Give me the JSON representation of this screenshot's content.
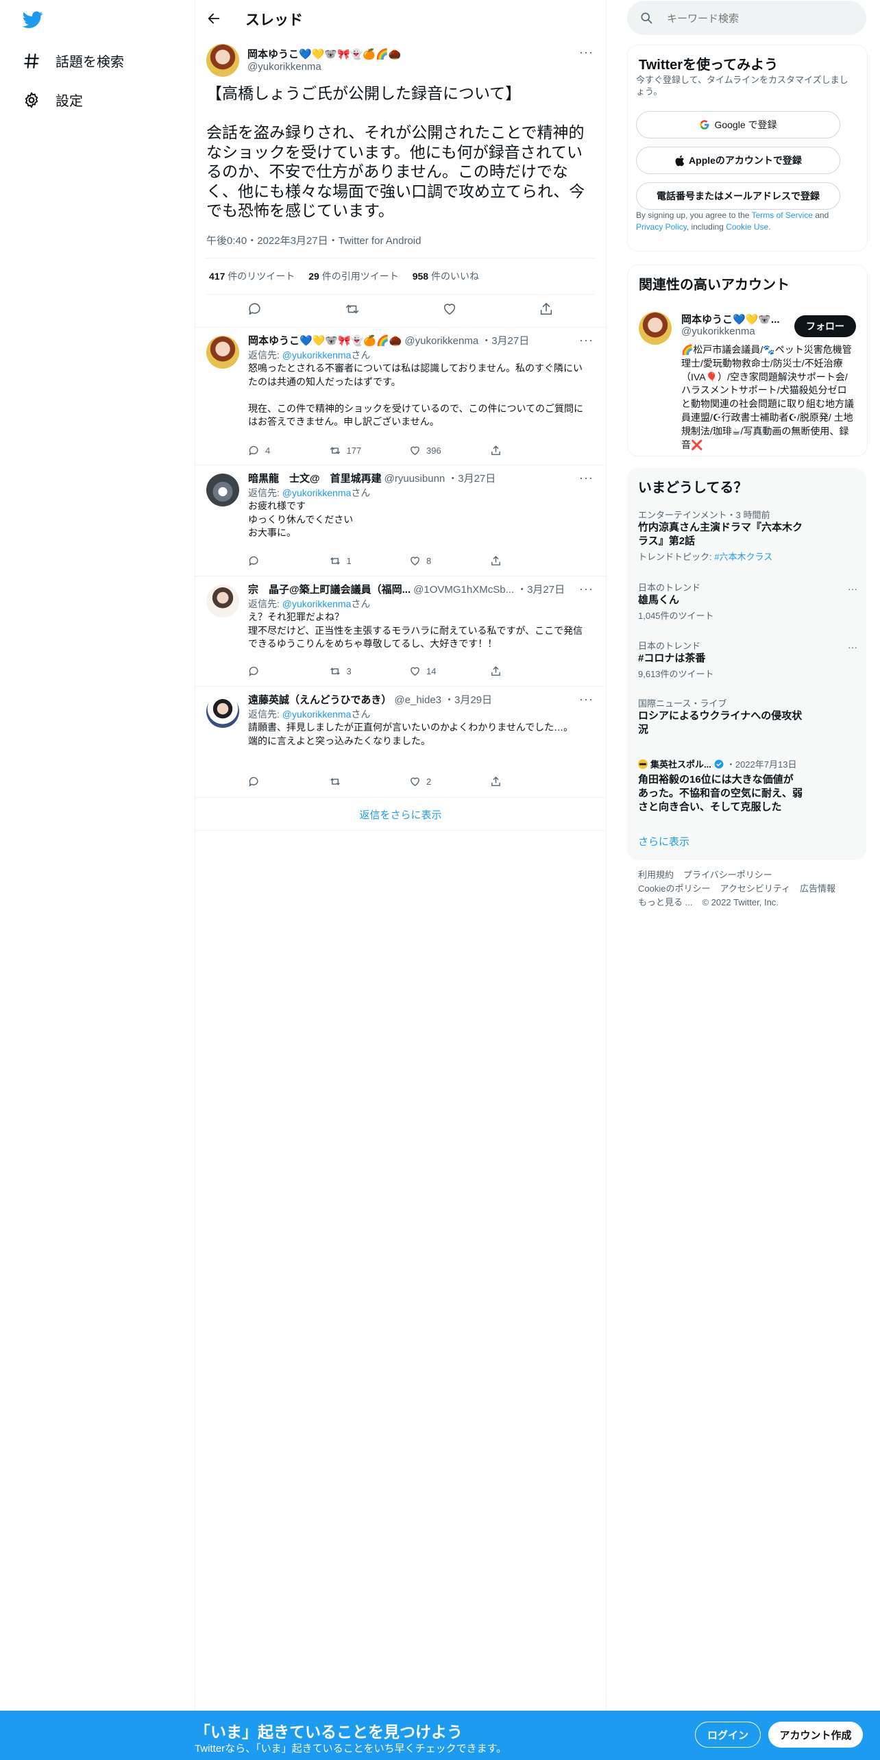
{
  "nav": {
    "logo": "twitter-bird",
    "explore_label": "話題を検索",
    "settings_label": "設定"
  },
  "header": {
    "title": "スレッド"
  },
  "main_tweet": {
    "name": "岡本ゆうこ💙💛🐨🎀👻🍊🌈🌰",
    "handle": "@yukorikkenma",
    "text": "【高橋しょうご氏が公開した録音について】\n\n会話を盗み録りされ、それが公開されたことで精神的なショックを受けています。他にも何が録音されているのか、不安で仕方がありません。この時だけでなく、他にも様々な場面で強い口調で攻め立てられ、今でも恐怖を感じています。",
    "meta": "午後0:40・2022年3月27日・Twitter for Android",
    "retweets": "417",
    "retweets_label": "件のリツイート",
    "quotes": "29",
    "quotes_label": "件の引用ツイート",
    "likes": "958",
    "likes_label": "件のいいね"
  },
  "replies": [
    {
      "name": "岡本ゆうこ💙💛🐨🎀👻🍊🌈🌰",
      "handle": "@yukorikkenma",
      "date": "・3月27日",
      "reply_prefix": "返信先: ",
      "reply_to": "@yukorikkenma",
      "reply_suffix": "さん",
      "text": "怒鳴ったとされる不審者については私は認識しておりません。私のすぐ隣にいたのは共通の知人だったはずです。\n\n現在、この件で精神的ショックを受けているので、この件についてのご質問にはお答えできません。申し訳ございません。",
      "reply_count": "4",
      "retweet_count": "177",
      "like_count": "396"
    },
    {
      "name": "暗黒龍　士文@　首里城再建",
      "handle": "@ryuusibunn",
      "date": "・3月27日",
      "reply_prefix": "返信先: ",
      "reply_to": "@yukorikkenma",
      "reply_suffix": "さん",
      "text": "お疲れ様です\nゆっくり休んでください\nお大事に。",
      "reply_count": "",
      "retweet_count": "1",
      "like_count": "8"
    },
    {
      "name": "宗　晶子@築上町議会議員（福岡...",
      "handle": "@1OVMG1hXMcSb...",
      "date": "・3月27日",
      "reply_prefix": "返信先: ",
      "reply_to": "@yukorikkenma",
      "reply_suffix": "さん",
      "text": "え？それ犯罪だよね？\n理不尽だけど、正当性を主張するモラハラに耐えている私ですが、ここで発信できるゆうこりんをめちゃ尊敬してるし、大好きです！！",
      "reply_count": "",
      "retweet_count": "3",
      "like_count": "14"
    },
    {
      "name": "遠藤英誠（えんどうひであき）",
      "handle": "@e_hide3",
      "date": "・3月29日",
      "reply_prefix": "返信先: ",
      "reply_to": "@yukorikkenma",
      "reply_suffix": "さん",
      "text": "請願書、拝見しましたが正直何が言いたいのかよくわかりませんでした…。\n端的に言えよと突っ込みたくなりました。",
      "reply_count": "",
      "retweet_count": "",
      "like_count": "2"
    }
  ],
  "show_more_replies": "返信をさらに表示",
  "search": {
    "placeholder": "キーワード検索"
  },
  "signup": {
    "title": "Twitterを使ってみよう",
    "subtitle": "今すぐ登録して、タイムラインをカスタマイズしましょう。",
    "google": "Google で登録",
    "apple": "Appleのアカウントで登録",
    "phone": "電話番号またはメールアドレスで登録",
    "legal_1": "By signing up, you agree to the ",
    "terms": "Terms of Service",
    "legal_2": " and ",
    "privacy": "Privacy Policy",
    "legal_3": ", including ",
    "cookie": "Cookie Use",
    "legal_4": "."
  },
  "related": {
    "title": "関連性の高いアカウント",
    "name": "岡本ゆうこ💙💛🐨...",
    "handle": "@yukorikkenma",
    "follow": "フォロー",
    "bio": "🌈松戸市議会議員/🐾ペット災害危機管理士/愛玩動物救命士/防災士/不妊治療（IVA🎈）/空き家問題解決サポート会/ ハラスメントサポート/犬猫殺処分ゼロと動物関連の社会問題に取り組む地方議員連盟/☪行政書士補助者☪/脱原発/ 土地規制法/珈琲☕/写真動画の無断使用、録音❌"
  },
  "trends": {
    "title": "いまどうしてる？",
    "items": [
      {
        "category": "エンターテインメント・3 時間前",
        "name": "竹内涼真さん主演ドラマ『六本木クラス』第2話",
        "extra_label": "トレンドトピック: ",
        "extra_link": "#六本木クラス"
      },
      {
        "category": "日本のトレンド",
        "name": "雄馬くん",
        "count": "1,045件のツイート"
      },
      {
        "category": "日本のトレンド",
        "name": "#コロナは茶番",
        "count": "9,613件のツイート"
      },
      {
        "category": "国際ニュース・ライブ",
        "name": "ロシアによるウクライナへの侵攻状況"
      },
      {
        "category": "集英社スポル...",
        "date": "・2022年7月13日",
        "name": "角田裕毅の16位には大きな価値があった。不協和音の空気に耐え、弱さと向き合い、そして克服した"
      }
    ],
    "show_more": "さらに表示"
  },
  "footer": {
    "links": [
      "利用規約",
      "プライバシーポリシー",
      "Cookieのポリシー",
      "アクセシビリティ",
      "広告情報",
      "もっと見る ..."
    ],
    "copyright": "© 2022 Twitter, Inc."
  },
  "bottom_bar": {
    "title": "「いま」起きていることを見つけよう",
    "subtitle": "Twitterなら、「いま」起きていることをいち早くチェックできます。",
    "login": "ログイン",
    "signup": "アカウント作成"
  },
  "colors": {
    "accent": "#1d9bf0",
    "text": "#0f1419",
    "muted": "#536471"
  }
}
